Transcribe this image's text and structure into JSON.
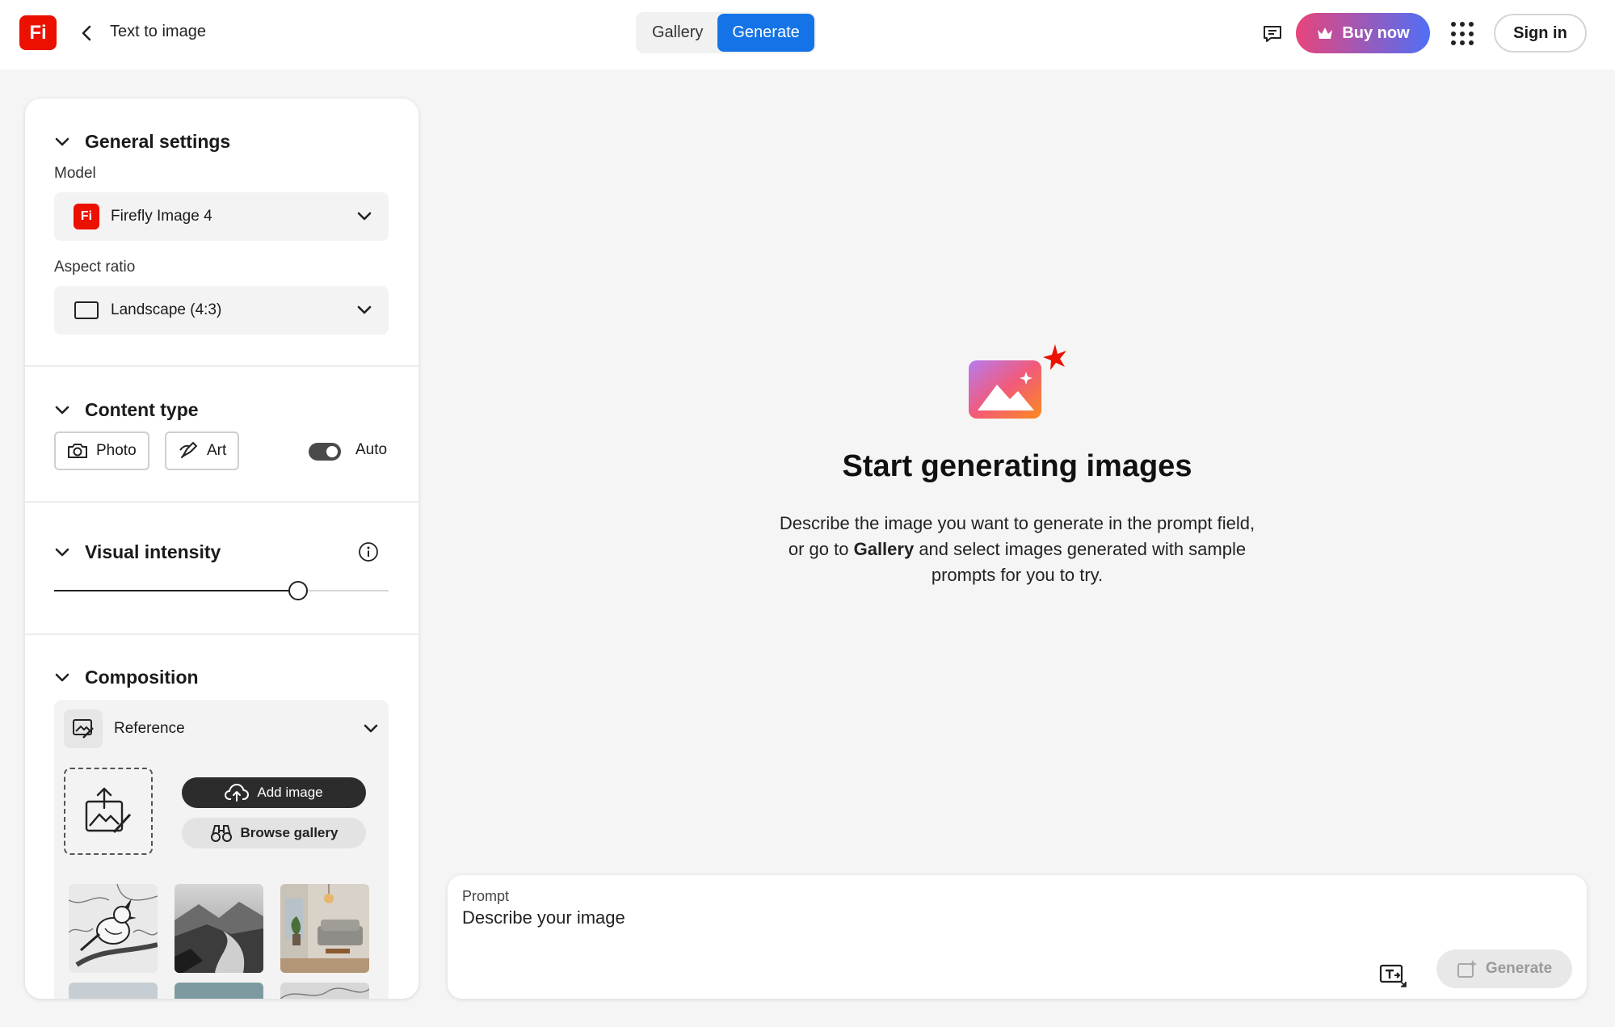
{
  "header": {
    "logo_text": "Fi",
    "page_title": "Text to image",
    "tabs": [
      {
        "label": "Gallery",
        "active": false
      },
      {
        "label": "Generate",
        "active": true
      }
    ],
    "buy_label": "Buy now",
    "signin_label": "Sign in"
  },
  "sidebar": {
    "general": {
      "title": "General settings",
      "model_label": "Model",
      "model_value": "Firefly Image 4",
      "model_logo_text": "Fi",
      "aspect_label": "Aspect ratio",
      "aspect_value": "Landscape (4:3)"
    },
    "content_type": {
      "title": "Content type",
      "options": [
        "Photo",
        "Art"
      ],
      "auto_label": "Auto",
      "auto_on": true
    },
    "visual_intensity": {
      "title": "Visual intensity",
      "value_fraction": 0.73
    },
    "composition": {
      "title": "Composition",
      "reference_label": "Reference",
      "add_image_label": "Add image",
      "browse_gallery_label": "Browse gallery"
    }
  },
  "main": {
    "title": "Start generating images",
    "desc_before": "Describe the image you want to generate in the prompt field, or go to ",
    "desc_bold": "Gallery",
    "desc_after": " and select images generated with sample prompts for you to try."
  },
  "prompt": {
    "label": "Prompt",
    "placeholder": "Describe your image",
    "generate_label": "Generate"
  },
  "colors": {
    "brand": "#eb1000",
    "accent": "#1473e6"
  }
}
